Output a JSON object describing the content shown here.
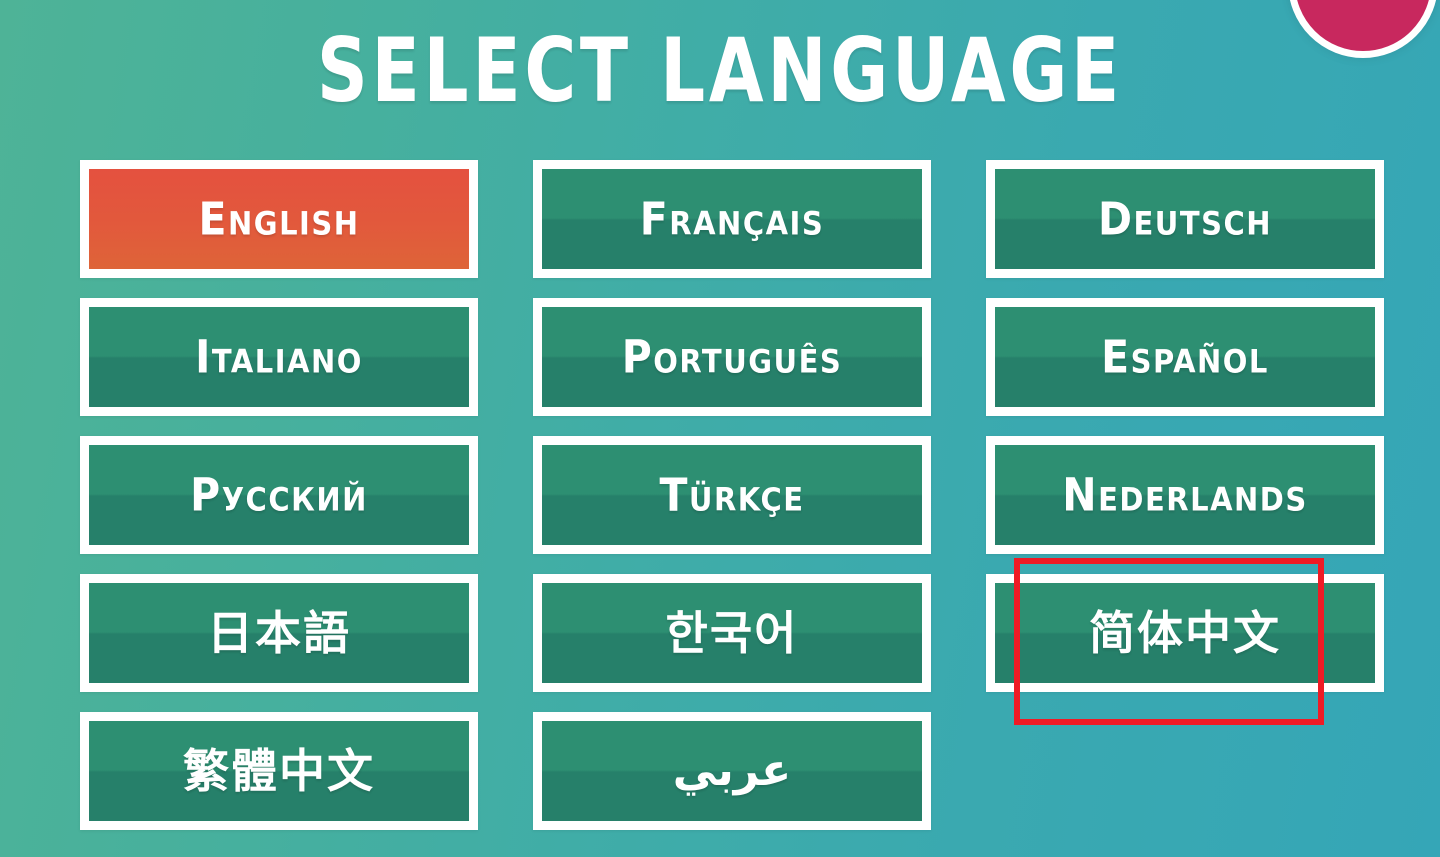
{
  "screen": {
    "title": "Select Language",
    "background_gradient_from": "#4eb397",
    "background_gradient_to": "#35a6b7"
  },
  "corner_badge": {
    "name": "badge-circle",
    "fill_color": "#c8285e",
    "ring_color": "#ffffff"
  },
  "languages": [
    {
      "label": "English",
      "selected": true,
      "script": "latin"
    },
    {
      "label": "Français",
      "selected": false,
      "script": "latin"
    },
    {
      "label": "Deutsch",
      "selected": false,
      "script": "latin"
    },
    {
      "label": "Italiano",
      "selected": false,
      "script": "latin"
    },
    {
      "label": "Português",
      "selected": false,
      "script": "latin"
    },
    {
      "label": "Español",
      "selected": false,
      "script": "latin"
    },
    {
      "label": "Русский",
      "selected": false,
      "script": "cyrillic"
    },
    {
      "label": "Türkçe",
      "selected": false,
      "script": "latin"
    },
    {
      "label": "Nederlands",
      "selected": false,
      "script": "latin"
    },
    {
      "label": "日本語",
      "selected": false,
      "script": "cjk"
    },
    {
      "label": "한국어",
      "selected": false,
      "script": "cjk"
    },
    {
      "label": "简体中文",
      "selected": false,
      "script": "cjk"
    },
    {
      "label": "繁體中文",
      "selected": false,
      "script": "cjk"
    },
    {
      "label": "عربي",
      "selected": false,
      "script": "rtl"
    }
  ],
  "selected_button_color": "#e4513f",
  "button_color": "#2d8f72",
  "button_border_color": "#ffffff",
  "annotation": {
    "target_label": "简体中文",
    "color": "#ef1b25"
  }
}
